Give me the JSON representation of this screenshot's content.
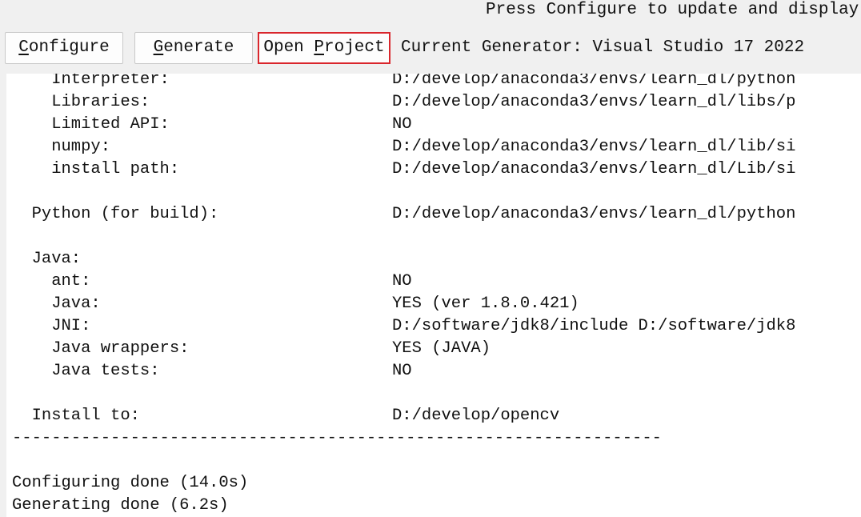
{
  "header": {
    "hint": "Press Configure to update and display n"
  },
  "toolbar": {
    "configure": {
      "accel": "C",
      "rest": "onfigure"
    },
    "generate": {
      "accel": "G",
      "rest": "enerate"
    },
    "open_project": {
      "pre": "Open ",
      "accel": "P",
      "rest": "roject"
    },
    "current_generator": "Current Generator: Visual Studio 17 2022"
  },
  "colors": {
    "highlight_border": "#d9262c",
    "output_background": "#ffffff",
    "window_background": "#f0f0f0"
  },
  "output": {
    "lines": [
      {
        "key": "    Interpreter:",
        "value": "D:/develop/anaconda3/envs/learn_dl/python"
      },
      {
        "key": "    Libraries:",
        "value": "D:/develop/anaconda3/envs/learn_dl/libs/p"
      },
      {
        "key": "    Limited API:",
        "value": "NO"
      },
      {
        "key": "    numpy:",
        "value": "D:/develop/anaconda3/envs/learn_dl/lib/si"
      },
      {
        "key": "    install path:",
        "value": "D:/develop/anaconda3/envs/learn_dl/Lib/si"
      },
      {
        "key": "",
        "value": ""
      },
      {
        "key": "  Python (for build):",
        "value": "D:/develop/anaconda3/envs/learn_dl/python"
      },
      {
        "key": "",
        "value": ""
      },
      {
        "key": "  Java:",
        "value": ""
      },
      {
        "key": "    ant:",
        "value": "NO"
      },
      {
        "key": "    Java:",
        "value": "YES (ver 1.8.0.421)"
      },
      {
        "key": "    JNI:",
        "value": "D:/software/jdk8/include D:/software/jdk8"
      },
      {
        "key": "    Java wrappers:",
        "value": "YES (JAVA)"
      },
      {
        "key": "    Java tests:",
        "value": "NO"
      },
      {
        "key": "",
        "value": ""
      },
      {
        "key": "  Install to:",
        "value": "D:/develop/opencv"
      }
    ],
    "separator": "------------------------------------------------------------------",
    "footer": [
      "",
      "Configuring done (14.0s)",
      "Generating done (6.2s)"
    ]
  }
}
